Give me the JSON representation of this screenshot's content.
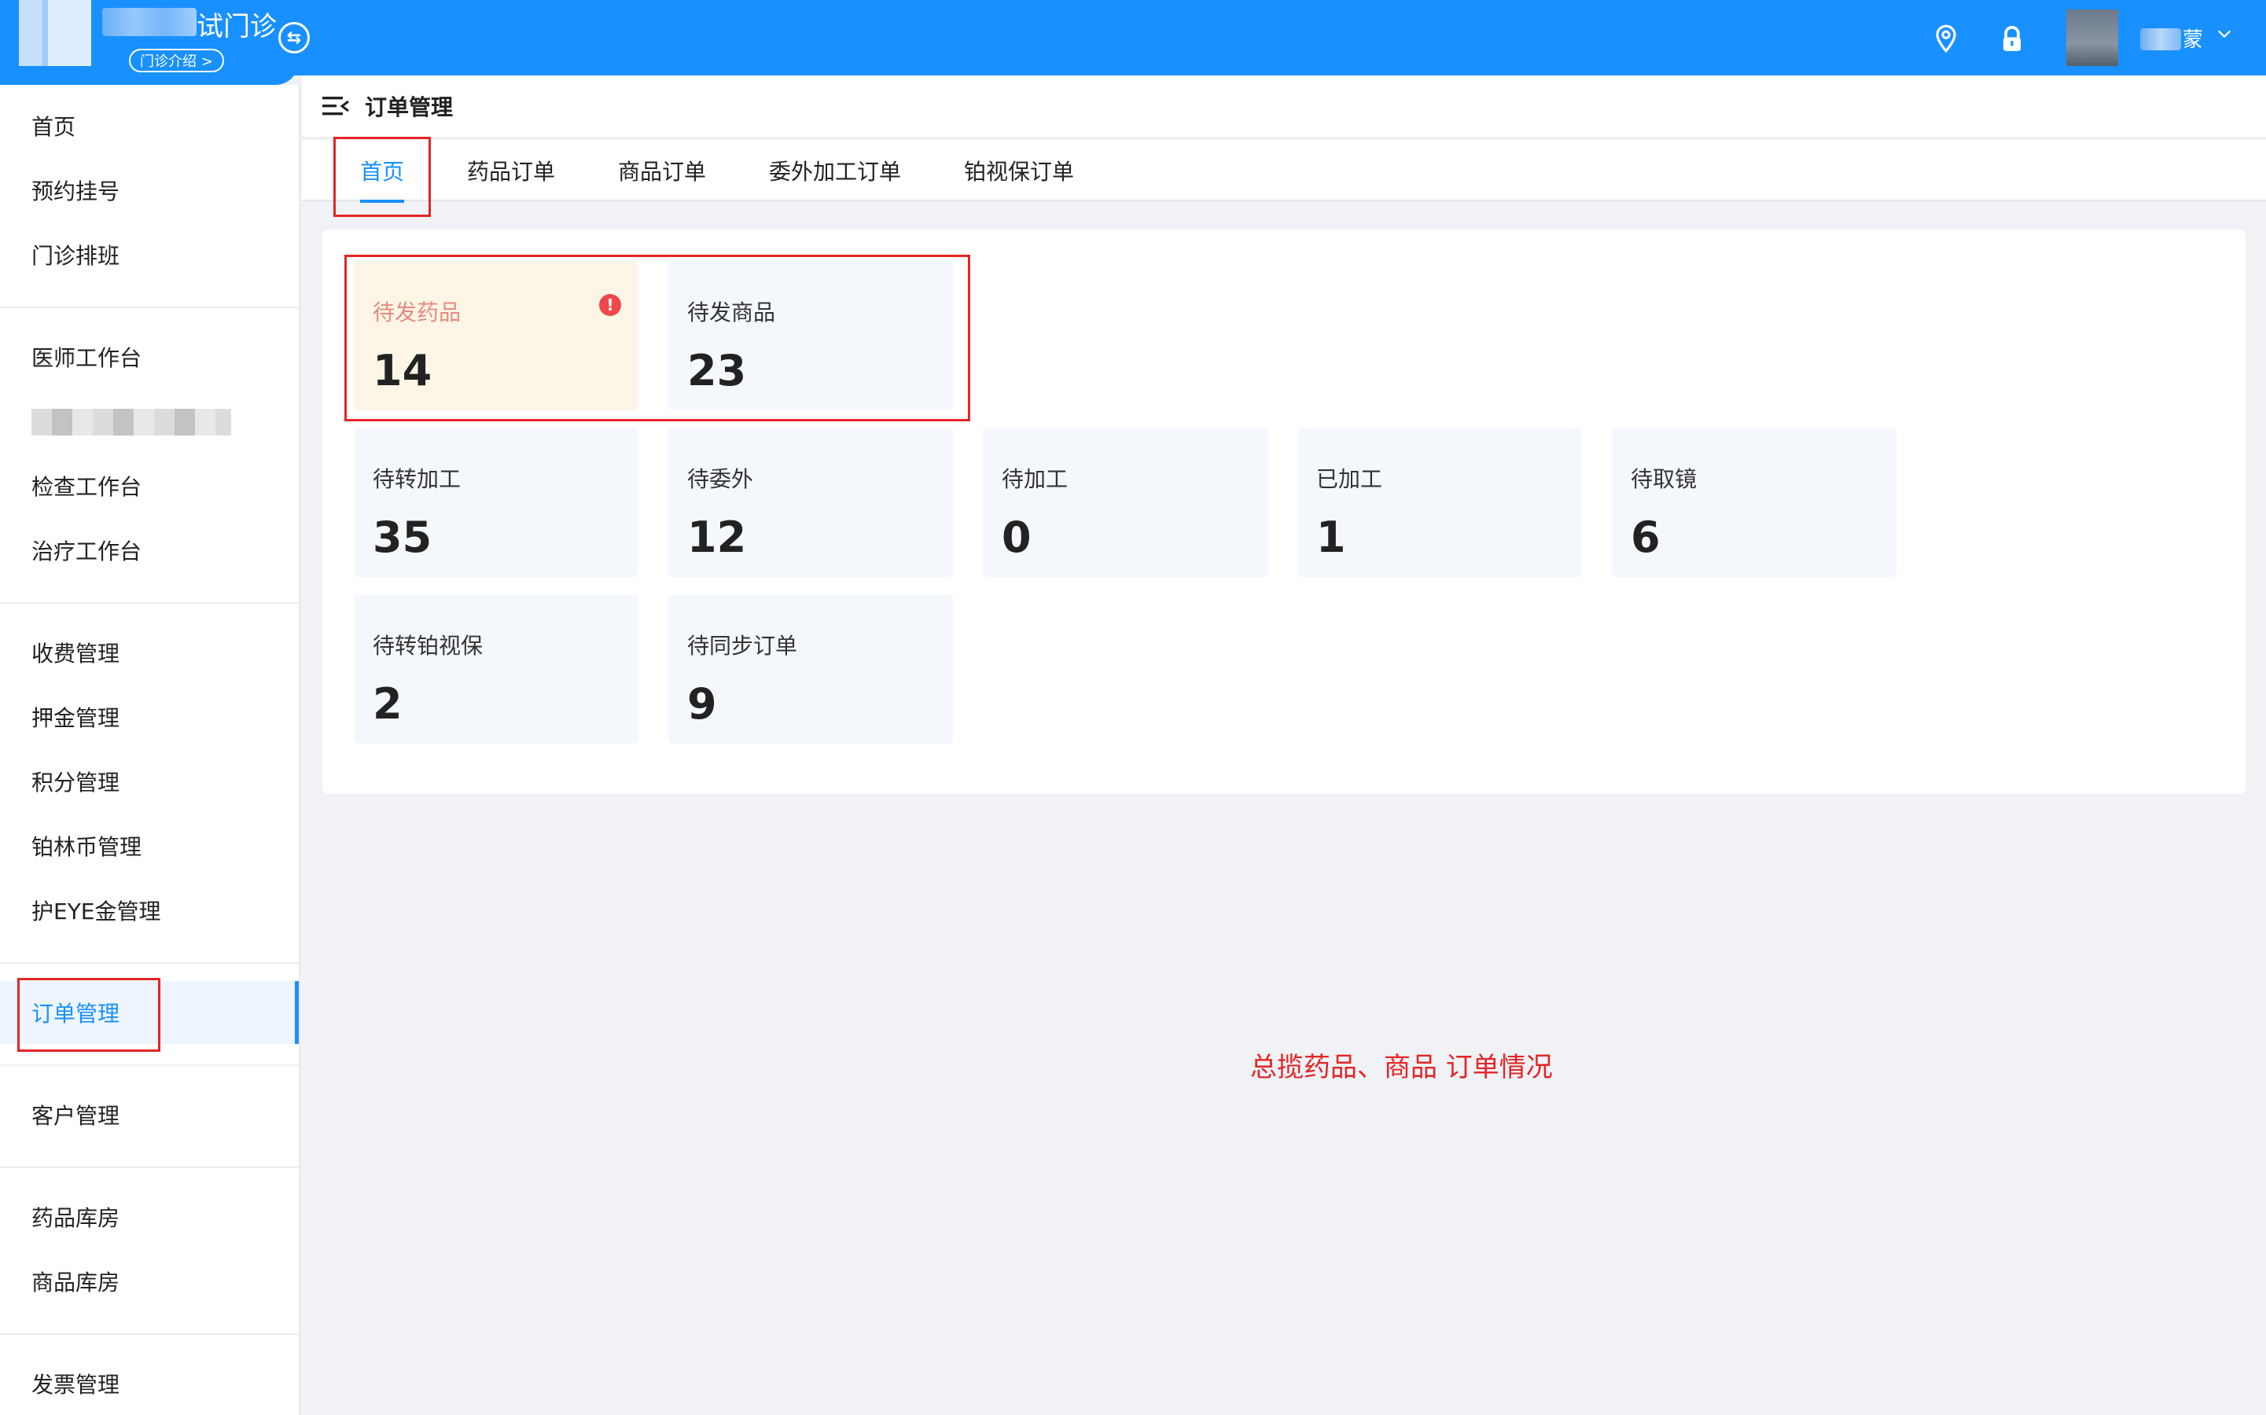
{
  "header": {
    "clinic_name": "试门诊",
    "clinic_intro": "门诊介绍 >",
    "user_name": "蒙"
  },
  "page": {
    "title": "订单管理"
  },
  "tabs": [
    {
      "label": "首页",
      "active": true
    },
    {
      "label": "药品订单"
    },
    {
      "label": "商品订单"
    },
    {
      "label": "委外加工订单"
    },
    {
      "label": "铂视保订单"
    }
  ],
  "sidebar": {
    "items": [
      {
        "label": "首页"
      },
      {
        "label": "预约挂号"
      },
      {
        "label": "门诊排班"
      },
      {
        "label": "医师工作台"
      },
      {
        "label": "检查工作台"
      },
      {
        "label": "治疗工作台"
      },
      {
        "label": "收费管理"
      },
      {
        "label": "押金管理"
      },
      {
        "label": "积分管理"
      },
      {
        "label": "铂林币管理"
      },
      {
        "label": "护EYE金管理"
      },
      {
        "label": "订单管理",
        "active": true
      },
      {
        "label": "客户管理"
      },
      {
        "label": "药品库房"
      },
      {
        "label": "商品库房"
      },
      {
        "label": "发票管理"
      }
    ]
  },
  "stats": [
    {
      "label": "待发药品",
      "value": "14",
      "alert": true
    },
    {
      "label": "待发商品",
      "value": "23"
    },
    {
      "label": "待转加工",
      "value": "35"
    },
    {
      "label": "待委外",
      "value": "12"
    },
    {
      "label": "待加工",
      "value": "0"
    },
    {
      "label": "已加工",
      "value": "1"
    },
    {
      "label": "待取镜",
      "value": "6"
    },
    {
      "label": "待转铂视保",
      "value": "2"
    },
    {
      "label": "待同步订单",
      "value": "9"
    }
  ],
  "annotation": {
    "text": "总揽药品、商品 订单情况"
  },
  "colors": {
    "primary": "#1890ff",
    "alert": "#f04848",
    "annotation": "#e42525"
  }
}
